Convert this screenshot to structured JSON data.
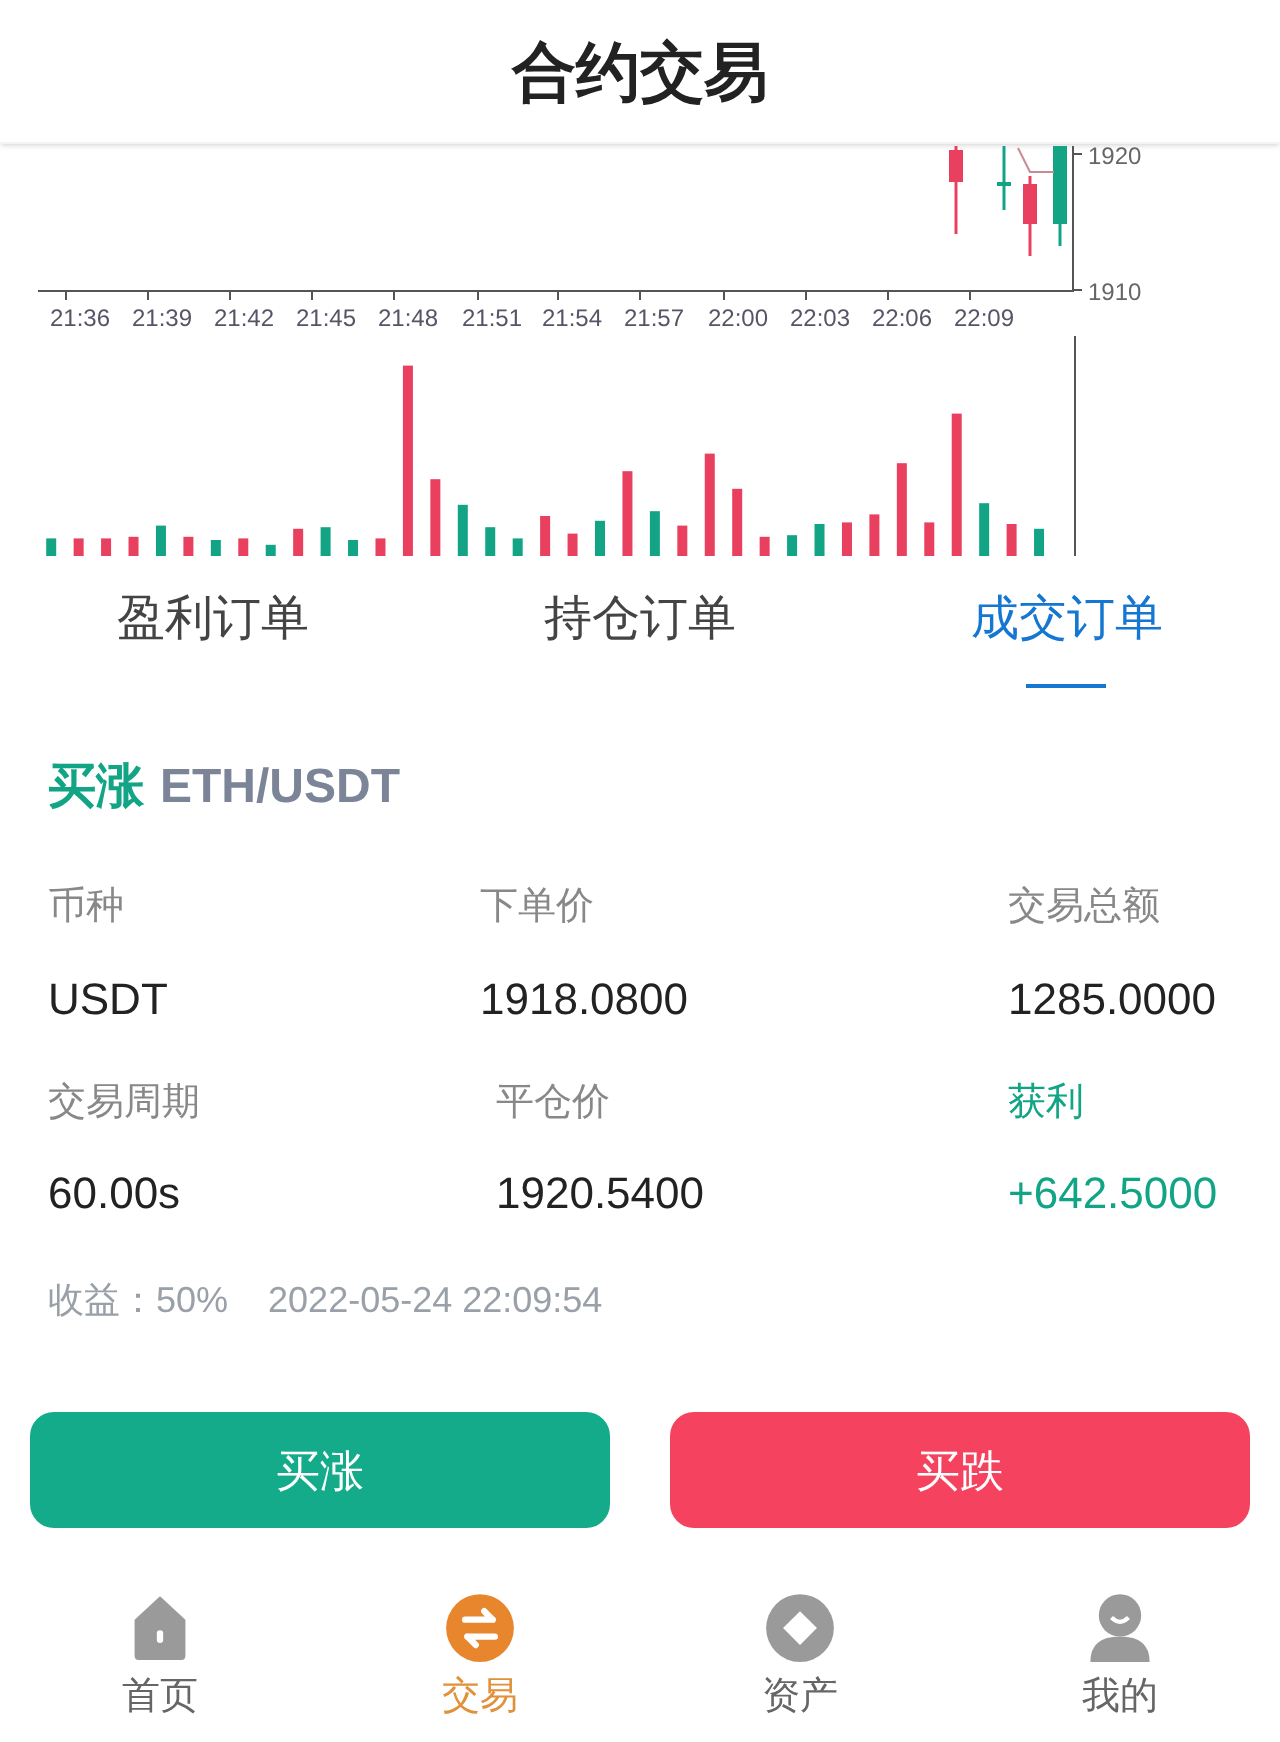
{
  "header": {
    "title": "合约交易"
  },
  "chart": {
    "y_labels": [
      "1920",
      "1910"
    ],
    "x_labels": [
      "21:36",
      "21:39",
      "21:42",
      "21:45",
      "21:48",
      "21:51",
      "21:54",
      "21:57",
      "22:00",
      "22:03",
      "22:06",
      "22:09"
    ]
  },
  "tabs": [
    {
      "label": "盈利订单",
      "selected": false
    },
    {
      "label": "持仓订单",
      "selected": false
    },
    {
      "label": "成交订单",
      "selected": true
    }
  ],
  "order": {
    "direction": "买涨",
    "pair": "ETH/USDT",
    "fields": [
      {
        "label": "币种",
        "value": "USDT",
        "kind": "plain"
      },
      {
        "label": "下单价",
        "value": "1918.0800",
        "kind": "plain"
      },
      {
        "label": "交易总额",
        "value": "1285.0000",
        "kind": "plain"
      },
      {
        "label": "交易周期",
        "value": "60.00s",
        "kind": "plain"
      },
      {
        "label": "平仓价",
        "value": "1920.5400",
        "kind": "plain"
      },
      {
        "label": "获利",
        "value": "+642.5000",
        "kind": "profit"
      }
    ],
    "yield": "收益：50%",
    "time": "2022-05-24 22:09:54"
  },
  "buttons": [
    {
      "label": "买涨",
      "kind": "up"
    },
    {
      "label": "买跌",
      "kind": "down"
    }
  ],
  "nav": [
    {
      "label": "首页",
      "kind": "home",
      "selected": false
    },
    {
      "label": "交易",
      "kind": "trade",
      "selected": true
    },
    {
      "label": "资产",
      "kind": "assets",
      "selected": false
    },
    {
      "label": "我的",
      "kind": "user",
      "selected": false
    }
  ]
}
